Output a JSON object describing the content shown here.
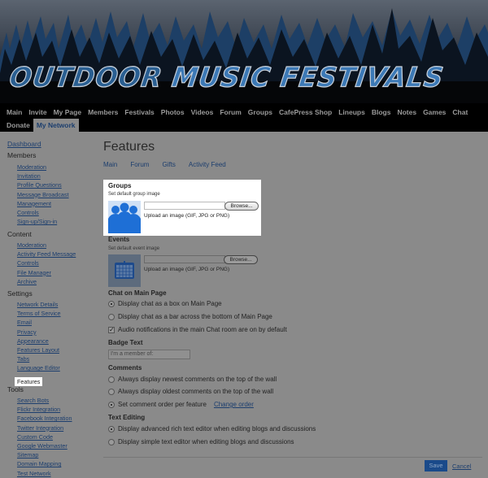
{
  "banner": {
    "title_word1": "OUTDOOR",
    "title_word2": "MUSIC FESTIVALS"
  },
  "nav": {
    "row1": [
      "Main",
      "Invite",
      "My Page",
      "Members",
      "Festivals",
      "Photos",
      "Videos",
      "Forum",
      "Groups",
      "CafePress Shop",
      "Lineups",
      "Blogs",
      "Notes",
      "Games",
      "Chat"
    ],
    "row2": [
      "Donate",
      "My Network"
    ],
    "active": "My Network"
  },
  "sidebar": {
    "dashboard": "Dashboard",
    "sections": [
      {
        "heading": "Members",
        "items": [
          "Moderation",
          "Invitation",
          "Profile Questions",
          "Message Broadcast",
          "Management",
          "Controls",
          "Sign-up/Sign-in"
        ]
      },
      {
        "heading": "Content",
        "items": [
          "Moderation",
          "Activity Feed Message",
          "Controls",
          "File Manager",
          "Archive"
        ]
      },
      {
        "heading": "Settings",
        "items": [
          "Network Details",
          "Terms of Service",
          "Email",
          "Privacy",
          "Appearance",
          "Features Layout",
          "Tabs",
          "Language Editor",
          "Features"
        ]
      },
      {
        "heading": "Tools",
        "items": [
          "Search Bots",
          "Flickr Integration",
          "Facebook Integration",
          "Twitter Integration",
          "Custom Code",
          "Google Webmaster",
          "Sitemap",
          "Domain Mapping",
          "Test Network"
        ]
      }
    ],
    "selected": "Features"
  },
  "main": {
    "title": "Features",
    "tabs": [
      "Main",
      "Forum",
      "Gifts",
      "Activity Feed"
    ],
    "groups": {
      "heading": "Groups",
      "sub": "Set default group image",
      "browse": "Browse...",
      "hint": "Upload an image (GIF, JPG or PNG)",
      "icon": "people-group-icon"
    },
    "events": {
      "heading": "Events",
      "sub": "Set default event image",
      "browse": "Browse...",
      "hint": "Upload an image (GIF, JPG or PNG)",
      "icon": "calendar-icon"
    },
    "chat": {
      "heading": "Chat on Main Page",
      "options": [
        "Display chat as a box on Main Page",
        "Display chat as a bar across the bottom of Main Page"
      ],
      "selected": 0,
      "audio_label": "Audio notifications in the main Chat room are on by default",
      "audio_checked": true
    },
    "badge": {
      "heading": "Badge Text",
      "value": "I'm a member of:"
    },
    "comments": {
      "heading": "Comments",
      "options": [
        "Always display newest comments on the top of the wall",
        "Always display oldest comments on the top of the wall",
        "Set comment order per feature"
      ],
      "selected": 2,
      "change_order": "Change order"
    },
    "text_editing": {
      "heading": "Text Editing",
      "options": [
        "Display advanced rich text editor when editing blogs and discussions",
        "Display simple text editor when editing blogs and discussions"
      ],
      "selected": 0
    },
    "save": "Save",
    "cancel": "Cancel"
  }
}
